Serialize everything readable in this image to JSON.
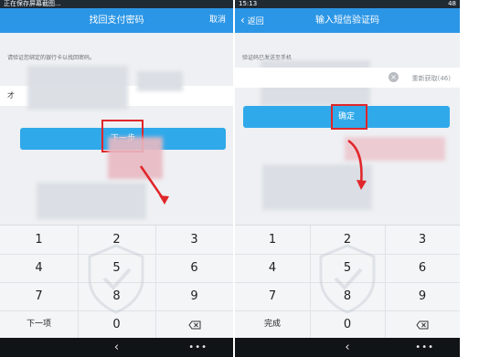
{
  "left": {
    "statusbar": {
      "text": "正在保存屏幕截图..."
    },
    "title": "找回支付密码",
    "cancel_label": "取消",
    "hint": "请验证您绑定的银行卡以找回密码。",
    "input_cursor": "才",
    "next_button_label": "下一步",
    "keypad": {
      "keys": [
        "1",
        "2",
        "3",
        "4",
        "5",
        "6",
        "7",
        "8",
        "9",
        "下一项",
        "0",
        "⌫"
      ]
    }
  },
  "right": {
    "statusbar": {
      "time": "15:13",
      "signal": "48"
    },
    "back_label": "返回",
    "title": "输入短信验证码",
    "hint": "验证码已发送至手机",
    "resend_label": "重新获取(46)",
    "confirm_button_label": "确定",
    "keypad": {
      "keys": [
        "1",
        "2",
        "3",
        "4",
        "5",
        "6",
        "7",
        "8",
        "9",
        "完成",
        "0",
        "⌫"
      ]
    }
  },
  "colors": {
    "accent": "#2c96e6",
    "button": "#30a9ea",
    "highlight": "#e0262a"
  },
  "icons": [
    "back-chevron-icon",
    "clear-icon",
    "backspace-icon",
    "shield-watermark-icon",
    "nav-back-icon",
    "nav-menu-icon"
  ]
}
